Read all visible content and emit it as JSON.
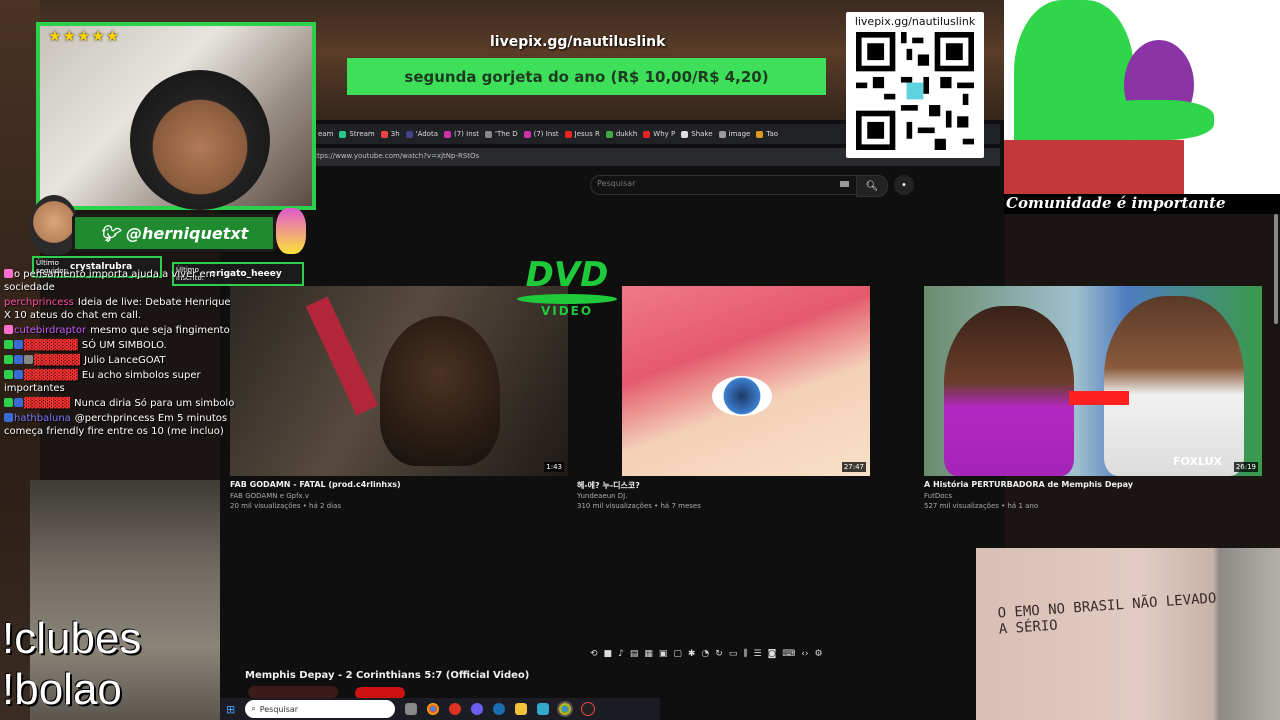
{
  "browser": {
    "tabs": [
      {
        "label": "eam",
        "color": "#c33"
      },
      {
        "label": "Stream",
        "color": "#2c8"
      },
      {
        "label": "3h",
        "color": "#e44"
      },
      {
        "label": "'Adota",
        "color": "#448"
      },
      {
        "label": "(7) Inst",
        "color": "#c3a"
      },
      {
        "label": "'The D",
        "color": "#888"
      },
      {
        "label": "(7) Inst",
        "color": "#c3a"
      },
      {
        "label": "Jesus R",
        "color": "#e22"
      },
      {
        "label": "dukkh",
        "color": "#4a4"
      },
      {
        "label": "Why P",
        "color": "#e22"
      },
      {
        "label": "Shake",
        "color": "#ddd"
      },
      {
        "label": "image",
        "color": "#999"
      },
      {
        "label": "Tao",
        "color": "#d92"
      }
    ],
    "url": "https://www.youtube.com/watch?v=xjtNp-RStOs"
  },
  "youtube": {
    "search_placeholder": "Pesquisar",
    "videos": [
      {
        "title": "FAB GODAMN - FATAL (prod.c4rlinhxs)",
        "channel": "FAB GODAMN e Gpfx.v",
        "meta": "20 mil visualizações • há 2 dias",
        "duration": "1:43"
      },
      {
        "title": "헤-에? 누-디스코?",
        "channel": "Yundeaeun DJ.",
        "meta": "310 mil visualizações • há 7 meses",
        "duration": "27:47"
      },
      {
        "title": "A História PERTURBADORA de Memphis Depay",
        "channel": "FutDocs",
        "meta": "527 mil visualizações • há 1 ano",
        "duration": "26:19"
      }
    ],
    "thumb3_brand": "FOXLUX",
    "now_playing": "Memphis Depay - 2 Corinthians 5:7 (Official Video)",
    "dvd_label": "DVD",
    "dvd_sub": "VIDEO"
  },
  "taskbar": {
    "search_placeholder": "Pesquisar"
  },
  "overlay": {
    "rating_stars": "★★★★★",
    "twitter_handle": "@herniquetxt",
    "follower_label": "Último seguidor:",
    "follower_name": "crystalrubra",
    "subscriber_label": "Último inscrito:",
    "subscriber_name": "arigato_heeey",
    "livepix_url": "livepix.gg/nautiluslink",
    "tip_message": "segunda gorjeta do ano (R$ 10,00/R$ 4,20)",
    "qr_url": "livepix.gg/nautiluslink",
    "cartoon_caption": "Comunidade é importante",
    "command_1": "!clubes",
    "command_2": "!bolao",
    "wall_graffiti": "O EMO NO BRASIL NÃO LEVADO A SÉRIO"
  },
  "chat": [
    {
      "user": "",
      "user_color": "#ffffff",
      "text": "o pensamento importa ajuda a viver em sociedade"
    },
    {
      "user": "perchprincess",
      "user_color": "#ff4fa3",
      "text": "Ideia de live: Debate Henrique X 10 ateus do chat em call."
    },
    {
      "user": "cutebirdraptor",
      "user_color": "#c95cff",
      "text": "mesmo que seja fingimento"
    },
    {
      "user": "",
      "user_color": "#ff3333",
      "text": "SÓ UM SIMBOLO."
    },
    {
      "user": "",
      "user_color": "#ff3333",
      "text": "Julio LanceGOAT"
    },
    {
      "user": "",
      "user_color": "#ff3333",
      "text": "Eu acho simbolos super importantes"
    },
    {
      "user": "",
      "user_color": "#ff3333",
      "text": "Nunca diria Só para um simbolo"
    },
    {
      "user": "hathbaluna",
      "user_color": "#7a7aff",
      "text": "@perchprincess Em 5 minutos começa friendly fire entre os 10 (me incluo)"
    }
  ]
}
